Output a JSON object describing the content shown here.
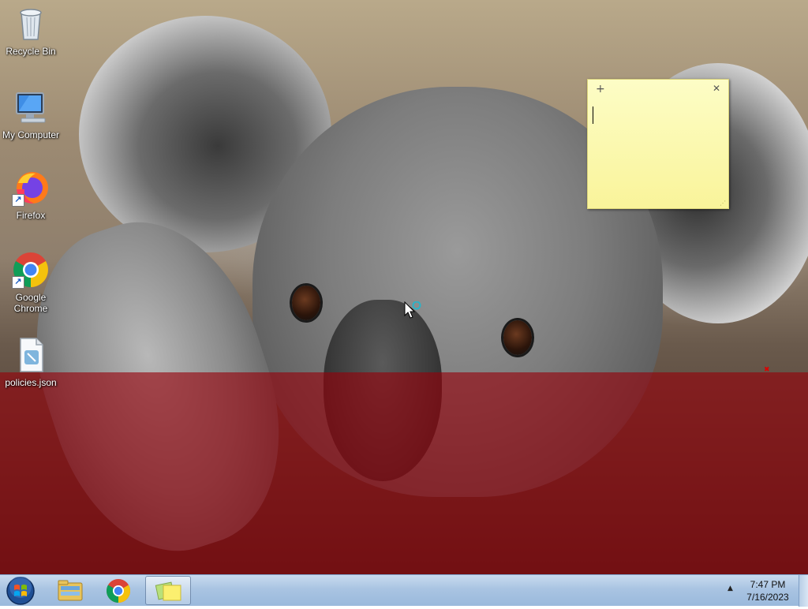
{
  "desktop": {
    "icons": [
      {
        "label": "Recycle Bin",
        "icon": "recycle-bin-icon"
      },
      {
        "label": "My Computer",
        "icon": "computer-icon"
      },
      {
        "label": "Firefox",
        "icon": "firefox-icon"
      },
      {
        "label": "Google Chrome",
        "icon": "chrome-icon"
      },
      {
        "label": "policies.json",
        "icon": "json-file-icon"
      }
    ],
    "wallpaper": "koala",
    "overlay_color": "#96000a"
  },
  "sticky_note": {
    "add_glyph": "+",
    "close_glyph": "✕",
    "text": "",
    "color": "#f9f49a"
  },
  "taskbar": {
    "start_icon": "windows-start-icon",
    "pinned": [
      {
        "icon": "file-explorer-icon",
        "active": false
      },
      {
        "icon": "chrome-icon",
        "active": false
      },
      {
        "icon": "sticky-notes-icon",
        "active": true
      }
    ],
    "tray_arrow": "▲",
    "clock": {
      "time": "7:47 PM",
      "date": "7/16/2023"
    }
  }
}
